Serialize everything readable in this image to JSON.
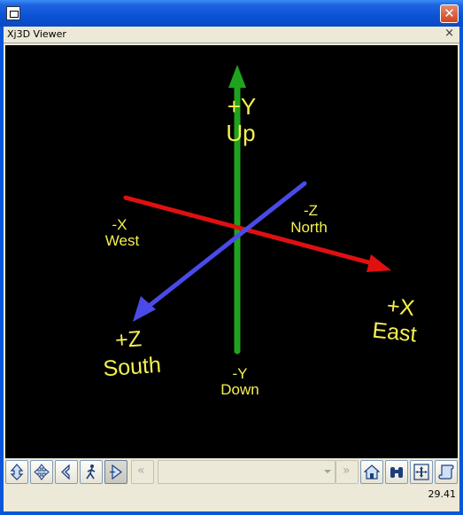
{
  "window": {
    "close_glyph": "✕"
  },
  "viewer": {
    "title": "Xj3D Viewer",
    "close_glyph": "×"
  },
  "scene": {
    "labels": {
      "plus_y": "+Y",
      "up": "Up",
      "minus_y": "-Y",
      "down": "Down",
      "minus_x": "-X",
      "west": "West",
      "plus_x": "+X",
      "east": "East",
      "minus_z": "-Z",
      "north": "North",
      "plus_z": "+Z",
      "south": "South"
    },
    "colors": {
      "x_axis": "#e01010",
      "y_axis": "#1fa31f",
      "z_axis": "#4a4ae8",
      "label": "#f5f050",
      "background": "#000000"
    }
  },
  "toolbar": {
    "buttons": [
      {
        "icon": "fly-icon"
      },
      {
        "icon": "pan-icon"
      },
      {
        "icon": "tilt-icon"
      },
      {
        "icon": "walk-icon"
      },
      {
        "icon": "examine-icon"
      }
    ],
    "prev_glyph": "«",
    "next_glyph": "»",
    "right_buttons": [
      {
        "icon": "home-icon"
      },
      {
        "icon": "binoculars-icon"
      },
      {
        "icon": "fit-view-icon"
      },
      {
        "icon": "scroll-icon"
      }
    ]
  },
  "status": {
    "fps": "29.41"
  }
}
